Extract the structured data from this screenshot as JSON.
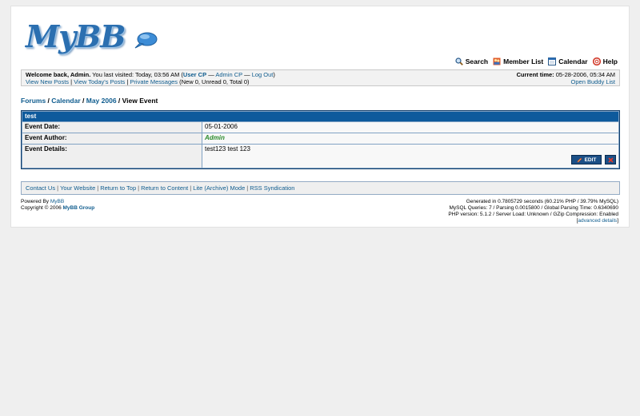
{
  "brand": {
    "logo_text": "MyBB"
  },
  "toplinks": [
    {
      "label": "Search",
      "icon": "search-icon"
    },
    {
      "label": "Member List",
      "icon": "members-icon"
    },
    {
      "label": "Calendar",
      "icon": "calendar-icon"
    },
    {
      "label": "Help",
      "icon": "help-icon"
    }
  ],
  "welcome": {
    "prefix": "Welcome back, Admin.",
    "visit": "You last visited: Today, 03:56 AM (",
    "user_cp": "User CP",
    "dash1": " — ",
    "admin_cp": "Admin CP",
    "dash2": " — ",
    "logout": "Log Out",
    "close": ")",
    "new_posts": "View New Posts",
    "todays_posts": "View Today's Posts",
    "pm": "Private Messages",
    "pm_counts": "(New 0, Unread 0, Total 0)",
    "sep": " | ",
    "current_time_label": "Current time:",
    "current_time": "05-28-2006, 05:34 AM",
    "buddy": "Open Buddy List"
  },
  "breadcrumb": {
    "forums": "Forums",
    "calendar": "Calendar",
    "month": "May 2006",
    "current": "View Event",
    "sep": " / "
  },
  "event": {
    "title": "test",
    "date_label": "Event Date:",
    "date": "05-01-2006",
    "author_label": "Event Author:",
    "author": "Admin",
    "details_label": "Event Details:",
    "details": "test123 test 123",
    "edit_label": "EDIT"
  },
  "footer_links": [
    "Contact Us",
    "Your Website",
    "Return to Top",
    "Return to Content",
    "Lite (Archive) Mode",
    "RSS Syndication"
  ],
  "copyright": {
    "powered_prefix": "Powered By",
    "powered_link": "MyBB",
    "copy_prefix": "Copyright © 2006",
    "copy_link": "MyBB Group"
  },
  "stats": {
    "line1": "Generated in 0.7805729 seconds (60.21% PHP / 39.79% MySQL)",
    "line2": "MySQL Queries: 7 / Parsing 0.0015800 / Global Parsing Time: 0.6340690",
    "line3": "PHP version: 5.1.2 / Server Load: Unknown / GZip Compression: Enabled",
    "advanced_open": "[",
    "advanced": "advanced details",
    "advanced_close": "]"
  }
}
